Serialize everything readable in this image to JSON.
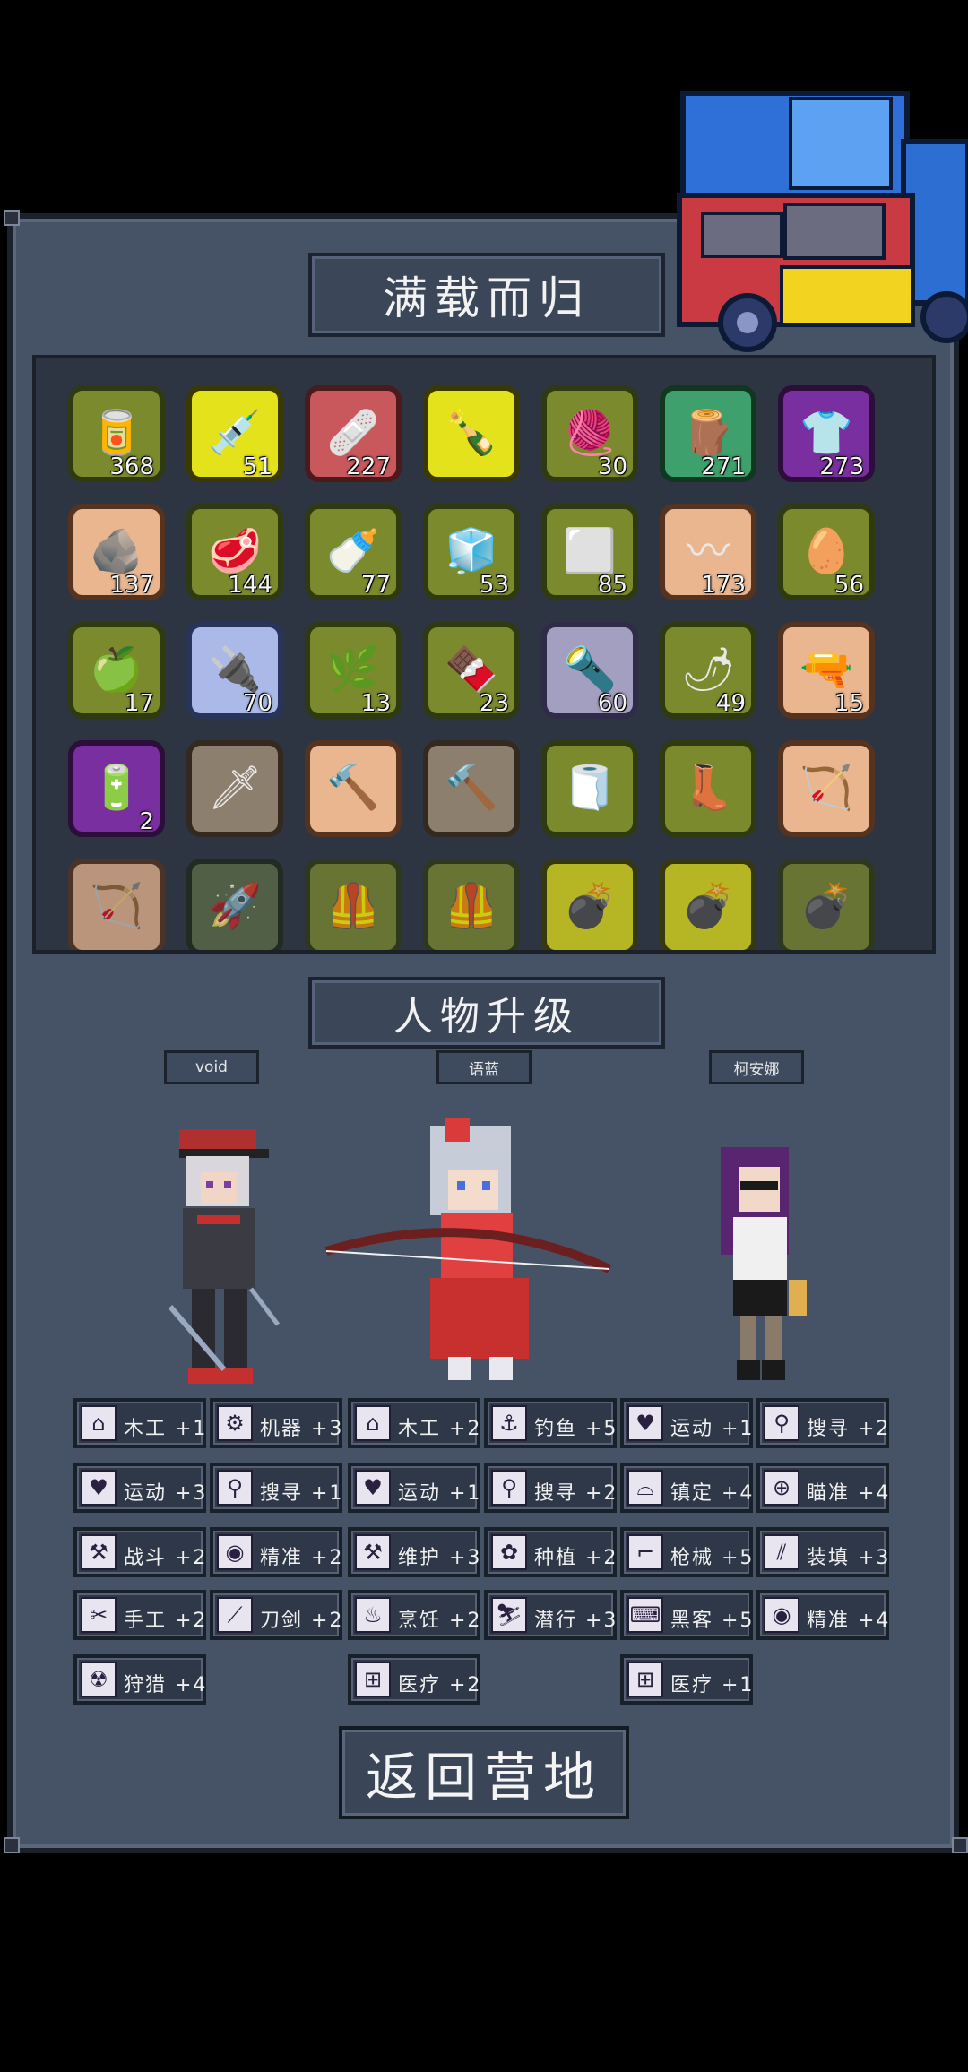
{
  "title": "满载而归",
  "upgrade_title": "人物升级",
  "return_button": "返回营地",
  "inventory": [
    {
      "icon": "canned-food-water-icon",
      "glyph": "🥫",
      "color": "c-olive",
      "qty": "368"
    },
    {
      "icon": "syringe-icon",
      "glyph": "💉",
      "color": "c-yellow",
      "qty": "51"
    },
    {
      "icon": "medkit-bandage-icon",
      "glyph": "🩹",
      "color": "c-red",
      "qty": "227"
    },
    {
      "icon": "molotov-bottle-icon",
      "glyph": "🍾",
      "color": "c-yellow",
      "qty": ""
    },
    {
      "icon": "cloth-icon",
      "glyph": "🧶",
      "color": "c-olive",
      "qty": "30"
    },
    {
      "icon": "wood-log-icon",
      "glyph": "🪵",
      "color": "c-green",
      "qty": "271"
    },
    {
      "icon": "shirt-icon",
      "glyph": "👕",
      "color": "c-purple",
      "qty": "273"
    },
    {
      "icon": "stone-icon",
      "glyph": "🪨",
      "color": "c-tan",
      "qty": "137"
    },
    {
      "icon": "raw-meat-icon",
      "glyph": "🥩",
      "color": "c-olive",
      "qty": "144"
    },
    {
      "icon": "milk-bottle-icon",
      "glyph": "🍼",
      "color": "c-olive",
      "qty": "77"
    },
    {
      "icon": "frozen-meat-icon",
      "glyph": "🧊",
      "color": "c-olive",
      "qty": "53"
    },
    {
      "icon": "cloth-scrap-icon",
      "glyph": "⬜",
      "color": "c-olive",
      "qty": "85"
    },
    {
      "icon": "rope-icon",
      "glyph": "〰",
      "color": "c-tan",
      "qty": "173"
    },
    {
      "icon": "egg-icon",
      "glyph": "🥚",
      "color": "c-olive",
      "qty": "56"
    },
    {
      "icon": "apple-icon",
      "glyph": "🍏",
      "color": "c-olive",
      "qty": "17"
    },
    {
      "icon": "circuit-board-icon",
      "glyph": "🔌",
      "color": "c-blue",
      "qty": "70"
    },
    {
      "icon": "herb-icon",
      "glyph": "🌿",
      "color": "c-olive",
      "qty": "13"
    },
    {
      "icon": "chocolate-icon",
      "glyph": "🍫",
      "color": "c-olive",
      "qty": "23"
    },
    {
      "icon": "flashlight-icon",
      "glyph": "🔦",
      "color": "c-lav",
      "qty": "60"
    },
    {
      "icon": "chili-pepper-icon",
      "glyph": "🌶",
      "color": "c-olive",
      "qty": "49"
    },
    {
      "icon": "rifle-icon",
      "glyph": "🔫",
      "color": "c-tan",
      "qty": "15"
    },
    {
      "icon": "battery-icon",
      "glyph": "🔋",
      "color": "c-purple",
      "qty": "2"
    },
    {
      "icon": "kunai-icon",
      "glyph": "🗡",
      "color": "c-brown",
      "qty": ""
    },
    {
      "icon": "hammer-icon",
      "glyph": "🔨",
      "color": "c-tan",
      "qty": ""
    },
    {
      "icon": "hammer-icon",
      "glyph": "🔨",
      "color": "c-brown",
      "qty": ""
    },
    {
      "icon": "bandage-roll-icon",
      "glyph": "🧻",
      "color": "c-olive",
      "qty": ""
    },
    {
      "icon": "boots-icon",
      "glyph": "👢",
      "color": "c-olive",
      "qty": ""
    },
    {
      "icon": "bow-icon",
      "glyph": "🏹",
      "color": "c-tan",
      "qty": ""
    },
    {
      "icon": "bow-icon",
      "glyph": "🏹",
      "color": "c-tanfade",
      "qty": ""
    },
    {
      "icon": "rocket-launcher-icon",
      "glyph": "🚀",
      "color": "c-dark",
      "qty": ""
    },
    {
      "icon": "vest-icon",
      "glyph": "🦺",
      "color": "c-olive",
      "qty": ""
    },
    {
      "icon": "vest-icon",
      "glyph": "🦺",
      "color": "c-olive",
      "qty": ""
    },
    {
      "icon": "grenade-icon",
      "glyph": "💣",
      "color": "c-yellow",
      "qty": ""
    },
    {
      "icon": "grenade-icon",
      "glyph": "💣",
      "color": "c-yellow",
      "qty": ""
    },
    {
      "icon": "grenade-icon",
      "glyph": "💣",
      "color": "c-olive",
      "qty": ""
    }
  ],
  "characters": [
    {
      "name": "void",
      "sprite": "boy-cap-sword",
      "colors": {
        "hair": "#d9d6dc",
        "coat": "#3b3b44",
        "accent": "#c43030"
      },
      "skills": [
        [
          "house-icon",
          "⌂",
          "木工 +1"
        ],
        [
          "gear-icon",
          "⚙",
          "机器 +3"
        ],
        [
          "heart-icon",
          "♥",
          "运动 +3"
        ],
        [
          "magnifier-icon",
          "⚲",
          "搜寻 +1"
        ],
        [
          "wrench-icon",
          "⚒",
          "战斗 +2"
        ],
        [
          "eye-icon",
          "◉",
          "精准 +2"
        ],
        [
          "scissors-icon",
          "✂",
          "手工 +2"
        ],
        [
          "blade-icon",
          "⟋",
          "刀剑 +2"
        ],
        [
          "radiation-icon",
          "☢",
          "狩猎 +4"
        ]
      ]
    },
    {
      "name": "语蓝",
      "sprite": "girl-bow",
      "colors": {
        "hair": "#c6ccd8",
        "coat": "#d93a3a",
        "accent": "#7a2020"
      },
      "skills": [
        [
          "house-icon",
          "⌂",
          "木工 +2"
        ],
        [
          "fishing-icon",
          "⚓",
          "钓鱼 +5"
        ],
        [
          "heart-icon",
          "♥",
          "运动 +1"
        ],
        [
          "magnifier-icon",
          "⚲",
          "搜寻 +2"
        ],
        [
          "wrench-icon",
          "⚒",
          "维护 +3"
        ],
        [
          "plant-icon",
          "✿",
          "种植 +2"
        ],
        [
          "pot-icon",
          "♨",
          "烹饪 +2"
        ],
        [
          "sneak-icon",
          "⛷",
          "潜行 +3"
        ],
        [
          "medkit-icon",
          "⊞",
          "医疗 +2"
        ]
      ]
    },
    {
      "name": "柯安娜",
      "sprite": "woman-glasses",
      "colors": {
        "hair": "#5a2570",
        "coat": "#f0f0f0",
        "accent": "#1a1a1a"
      },
      "skills": [
        [
          "heart-icon",
          "♥",
          "运动 +1"
        ],
        [
          "magnifier-icon",
          "⚲",
          "搜寻 +2"
        ],
        [
          "glasses-icon",
          "⌓",
          "镇定 +4"
        ],
        [
          "target-icon",
          "⊕",
          "瞄准 +4"
        ],
        [
          "gun-icon",
          "⌐",
          "枪械 +5"
        ],
        [
          "reload-icon",
          "⫽",
          "装填 +3"
        ],
        [
          "hacker-icon",
          "⌨",
          "黑客 +5"
        ],
        [
          "eye-icon",
          "◉",
          "精准 +4"
        ],
        [
          "medkit-icon",
          "⊞",
          "医疗 +1"
        ]
      ]
    }
  ]
}
